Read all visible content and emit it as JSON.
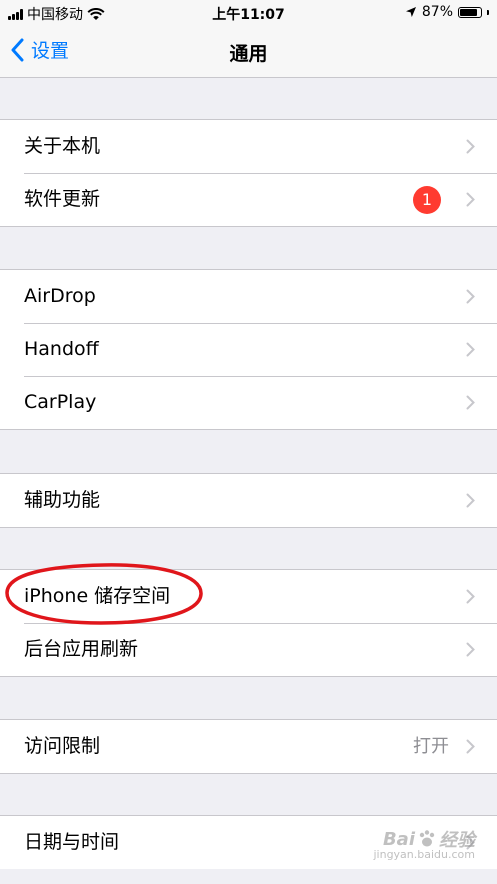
{
  "status_bar": {
    "carrier": "中国移动",
    "time": "上午11:07",
    "battery_percent": "87%",
    "battery_level": 0.87,
    "icons": [
      "signal-bars",
      "wifi",
      "location-arrow",
      "battery"
    ]
  },
  "nav": {
    "back_label": "设置",
    "title": "通用"
  },
  "groups": [
    [
      {
        "label": "关于本机"
      },
      {
        "label": "软件更新",
        "badge": "1"
      }
    ],
    [
      {
        "label": "AirDrop"
      },
      {
        "label": "Handoff"
      },
      {
        "label": "CarPlay"
      }
    ],
    [
      {
        "label": "辅助功能"
      }
    ],
    [
      {
        "label": "iPhone 储存空间"
      },
      {
        "label": "后台应用刷新"
      }
    ],
    [
      {
        "label": "访问限制",
        "detail": "打开"
      }
    ],
    [
      {
        "label": "日期与时间"
      }
    ]
  ],
  "annotation": {
    "color": "#e0161b"
  },
  "colors": {
    "accent": "#007aff",
    "badge": "#ff3b30",
    "background": "#efeff4"
  },
  "watermark": {
    "brand": "Bai",
    "brand2": "经验",
    "sub": "jingyan.baidu.com"
  }
}
